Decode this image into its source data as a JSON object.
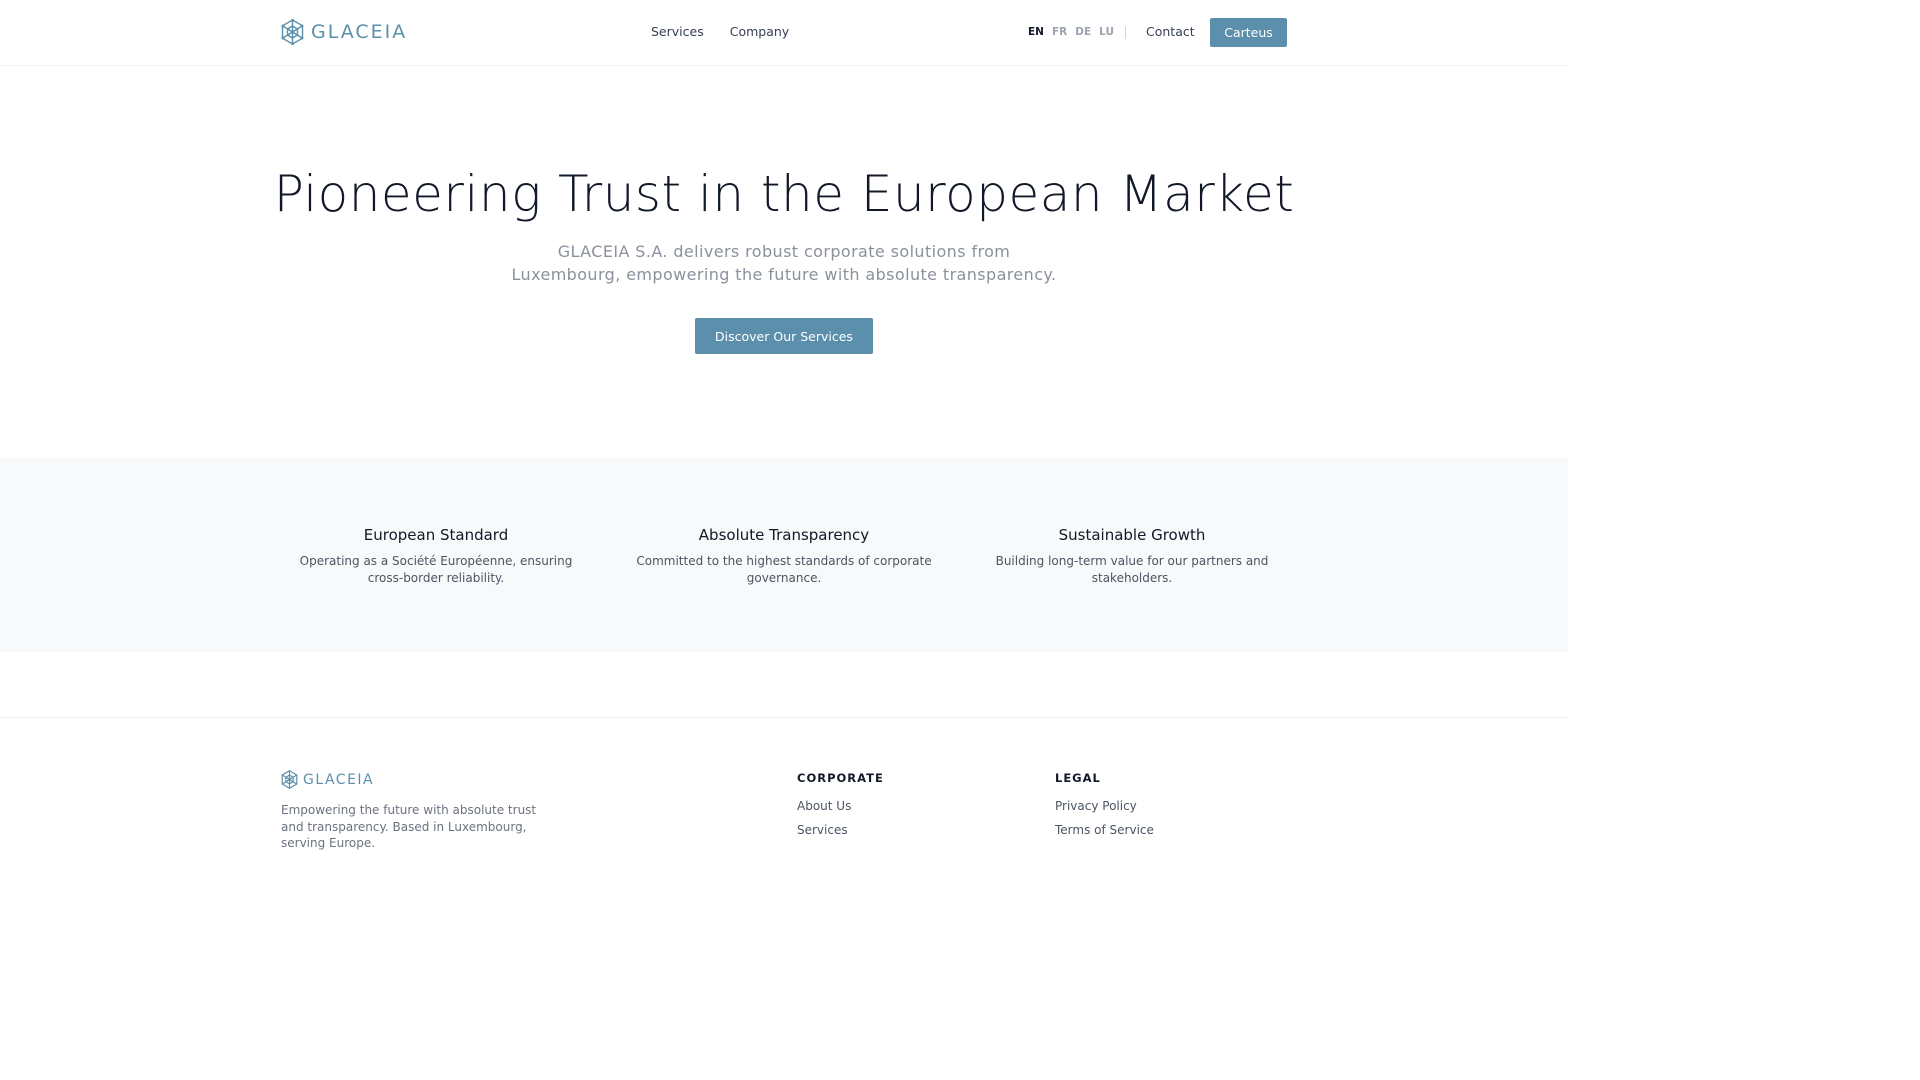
{
  "header": {
    "logo_text": "GLACEIA",
    "nav": [
      {
        "label": "Services"
      },
      {
        "label": "Company"
      }
    ],
    "languages": [
      {
        "code": "EN",
        "active": true
      },
      {
        "code": "FR",
        "active": false
      },
      {
        "code": "DE",
        "active": false
      },
      {
        "code": "LU",
        "active": false
      }
    ],
    "contact_label": "Contact",
    "cta_label": "Carteus"
  },
  "hero": {
    "title": "Pioneering Trust in the European Market",
    "subtitle": "GLACEIA S.A. delivers robust corporate solutions from Luxembourg, empowering the future with absolute transparency.",
    "button_label": "Discover Our Services"
  },
  "features": [
    {
      "title": "European Standard",
      "text": "Operating as a Société Européenne, ensuring cross-border reliability."
    },
    {
      "title": "Absolute Transparency",
      "text": "Committed to the highest standards of corporate governance."
    },
    {
      "title": "Sustainable Growth",
      "text": "Building long-term value for our partners and stakeholders."
    }
  ],
  "footer": {
    "logo_text": "GLACEIA",
    "tagline": "Empowering the future with absolute trust and transparency. Based in Luxembourg, serving Europe.",
    "columns": [
      {
        "heading": "CORPORATE",
        "links": [
          "About Us",
          "Services"
        ]
      },
      {
        "heading": "LEGAL",
        "links": [
          "Privacy Policy",
          "Terms of Service"
        ]
      }
    ]
  },
  "colors": {
    "accent": "#5b8fab",
    "feature_bg": "#f8f9fa"
  }
}
